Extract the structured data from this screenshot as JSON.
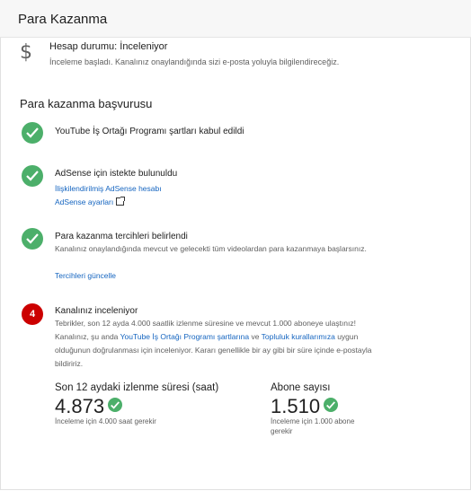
{
  "header": {
    "title": "Para Kazanma"
  },
  "account_status": {
    "icon": "dollar-icon",
    "title": "Hesap durumu: İnceleniyor",
    "description": "İnceleme başladı. Kanalınız onaylandığında sizi e-posta yoluyla bilgilendireceğiz."
  },
  "application": {
    "title": "Para kazanma başvurusu",
    "steps": [
      {
        "status": "done",
        "title": "YouTube İş Ortağı Programı şartları kabul edildi"
      },
      {
        "status": "done",
        "title": "AdSense için istekte bulunuldu",
        "link1": "İlişkilendirilmiş AdSense hesabı",
        "link2": "AdSense ayarları"
      },
      {
        "status": "done",
        "title": "Para kazanma tercihleri belirlendi",
        "text": "Kanalınız onaylandığında mevcut ve gelecekti tüm videolardan para kazanmaya başlarsınız.",
        "link1": "Tercihleri güncelle"
      },
      {
        "status": "pending",
        "number": "4",
        "title": "Kanalınız inceleniyor",
        "text_part1": "Tebrikler, son 12 ayda 4.000 saatlik izlenme süresine ve mevcut 1.000 aboneye ulaştınız! Kanalınız, şu anda ",
        "link_a": "YouTube İş Ortağı Programı şartlarına",
        "text_part2": " ve ",
        "link_b": "Topluluk kurallarımıza",
        "text_part3": " uygun olduğunun doğrulanması için inceleniyor. Kararı genellikle bir ay gibi bir süre içinde e-postayla bildiririz."
      }
    ]
  },
  "metrics": {
    "watch_time": {
      "label": "Son 12 aydaki izlenme süresi (saat)",
      "value": "4.873",
      "note": "İnceleme için 4.000 saat gerekir"
    },
    "subscribers": {
      "label": "Abone sayısı",
      "value": "1.510",
      "note": "İnceleme için 1.000 abone gerekir"
    }
  },
  "colors": {
    "check": "#4caf6a",
    "pending": "#cc0000",
    "link": "#1565c0"
  }
}
